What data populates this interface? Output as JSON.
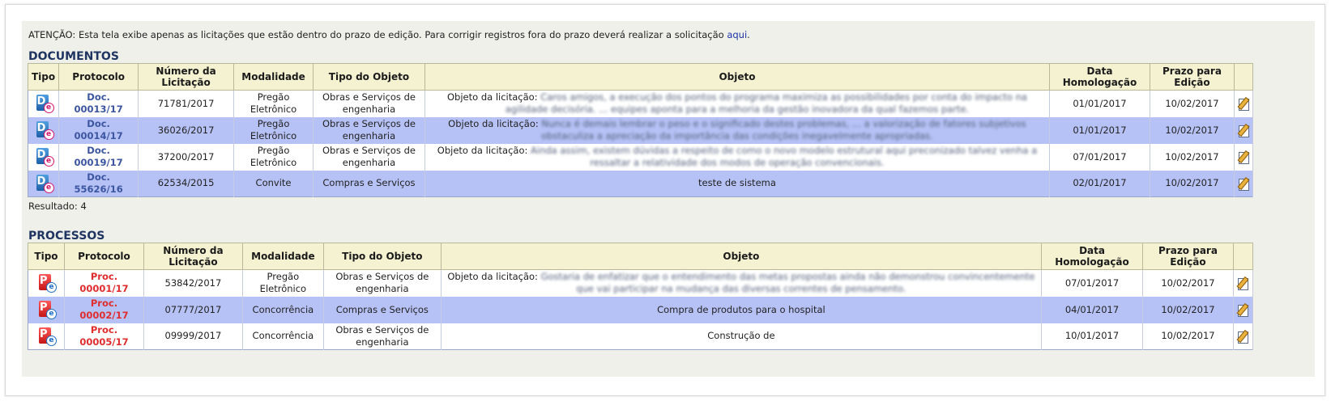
{
  "notice": {
    "text": "ATENÇÃO: Esta tela exibe apenas as licitações que estão dentro do prazo de edição. Para corrigir registros fora do prazo deverá realizar a solicitação ",
    "link": "aqui",
    "suffix": "."
  },
  "documentos": {
    "title": "DOCUMENTOS",
    "headers": {
      "tipo": "Tipo",
      "protocolo": "Protocolo",
      "numero": "Número da Licitação",
      "modalidade": "Modalidade",
      "tipo_objeto": "Tipo do Objeto",
      "objeto": "Objeto",
      "data": "Data Homologação",
      "prazo": "Prazo para Edição"
    },
    "rows": [
      {
        "icon": "document-e-icon",
        "protocolo": "Doc. 00013/17",
        "numero": "71781/2017",
        "modalidade": "Pregão Eletrônico",
        "tipo_objeto": "Obras e Serviços de engenharia",
        "objeto_prefix": "Objeto da licitação:",
        "objeto": "Caros amigos, a execução dos pontos do programa maximiza as possibilidades por conta do impacto na agilidade decisória. ... equipes aponta para a melhoria da gestão inovadora da qual fazemos parte.",
        "data": "01/01/2017",
        "prazo": "10/02/2017"
      },
      {
        "icon": "document-e-icon",
        "protocolo": "Doc. 00014/17",
        "numero": "36026/2017",
        "modalidade": "Pregão Eletrônico",
        "tipo_objeto": "Obras e Serviços de engenharia",
        "objeto_prefix": "Objeto da licitação:",
        "objeto": "Nunca é demais lembrar o peso e o significado destes problemas, ... a valorização de fatores subjetivos obstaculiza a apreciação da importância das condições inegavelmente apropriadas.",
        "data": "01/01/2017",
        "prazo": "10/02/2017"
      },
      {
        "icon": "document-e-icon",
        "protocolo": "Doc. 00019/17",
        "numero": "37200/2017",
        "modalidade": "Pregão Eletrônico",
        "tipo_objeto": "Obras e Serviços de engenharia",
        "objeto_prefix": "Objeto da licitação:",
        "objeto": "Ainda assim, existem dúvidas a respeito de como o novo modelo estrutural aqui preconizado talvez venha a ressaltar a relatividade dos modos de operação convencionais.",
        "data": "07/01/2017",
        "prazo": "10/02/2017"
      },
      {
        "icon": "document-e-icon",
        "protocolo": "Doc. 55626/16",
        "numero": "62534/2015",
        "modalidade": "Convite",
        "tipo_objeto": "Compras e Serviços",
        "objeto_prefix": "",
        "objeto": "teste de sistema",
        "data": "02/01/2017",
        "prazo": "10/02/2017"
      }
    ],
    "result": "Resultado: 4"
  },
  "processos": {
    "title": "PROCESSOS",
    "headers": {
      "tipo": "Tipo",
      "protocolo": "Protocolo",
      "numero": "Número da Licitação",
      "modalidade": "Modalidade",
      "tipo_objeto": "Tipo do Objeto",
      "objeto": "Objeto",
      "data": "Data Homologação",
      "prazo": "Prazo para Edição"
    },
    "rows": [
      {
        "icon": "process-e-icon",
        "protocolo": "Proc. 00001/17",
        "numero": "53842/2017",
        "modalidade": "Pregão Eletrônico",
        "tipo_objeto": "Obras e Serviços de engenharia",
        "objeto_prefix": "Objeto da licitação:",
        "objeto": "Gostaria de enfatizar que o entendimento das metas propostas ainda não demonstrou convincentemente que vai participar na mudança das diversas correntes de pensamento.",
        "data": "07/01/2017",
        "prazo": "10/02/2017"
      },
      {
        "icon": "process-e-icon",
        "protocolo": "Proc. 00002/17",
        "numero": "07777/2017",
        "modalidade": "Concorrência",
        "tipo_objeto": "Compras e Serviços",
        "objeto_prefix": "",
        "objeto": "Compra de produtos para o hospital",
        "data": "04/01/2017",
        "prazo": "10/02/2017"
      },
      {
        "icon": "process-e-icon",
        "protocolo": "Proc. 00005/17",
        "numero": "09999/2017",
        "modalidade": "Concorrência",
        "tipo_objeto": "Obras e Serviços de engenharia",
        "objeto_prefix": "",
        "objeto": "Construção de",
        "data": "10/01/2017",
        "prazo": "10/02/2017"
      }
    ]
  }
}
